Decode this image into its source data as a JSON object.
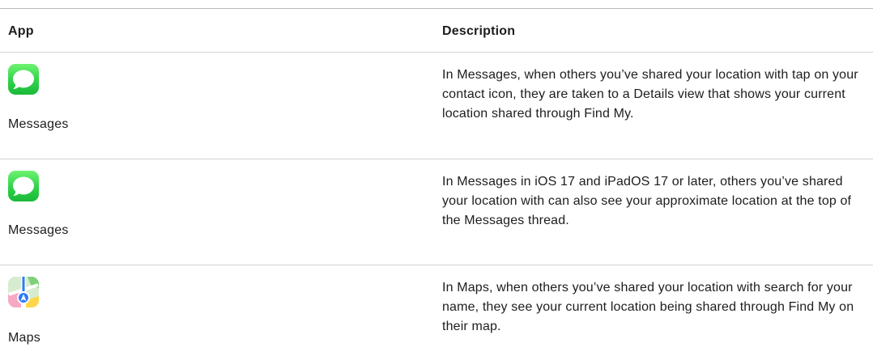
{
  "table": {
    "headers": {
      "app": "App",
      "description": "Description"
    },
    "rows": [
      {
        "app_name": "Messages",
        "icon": "messages-icon",
        "description": "In Messages, when others you’ve shared your location with tap on your contact icon, they are taken to a Details view that shows your current location shared through Find My."
      },
      {
        "app_name": "Messages",
        "icon": "messages-icon",
        "description": "In Messages in iOS 17 and iPadOS 17 or later, others you’ve shared your location with can also see your approximate location at the top of the Messages thread."
      },
      {
        "app_name": "Maps",
        "icon": "maps-icon",
        "description": "In Maps, when others you’ve shared your location with search for your name, they see your current location being shared through Find My on their map."
      }
    ]
  },
  "colors": {
    "messages_green": "#30d158",
    "text": "#1d1d1f",
    "divider": "#d2d2d7"
  }
}
